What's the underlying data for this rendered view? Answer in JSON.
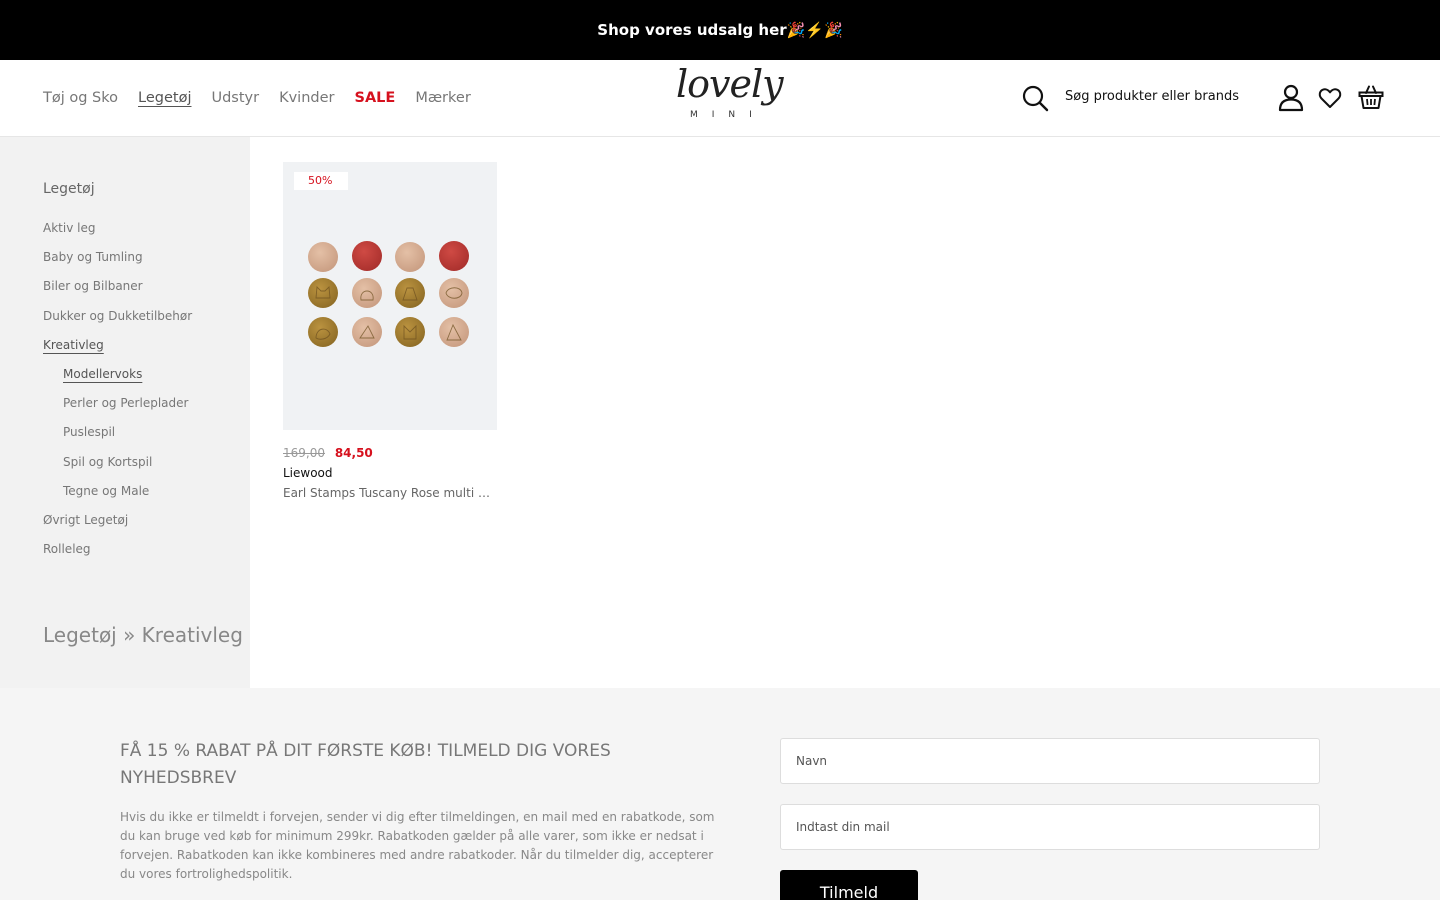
{
  "topbar": {
    "promo_text": "Shop vores udsalg her🎉⚡️🎉"
  },
  "nav": {
    "items": [
      {
        "label": "Tøj og Sko"
      },
      {
        "label": "Legetøj"
      },
      {
        "label": "Udstyr"
      },
      {
        "label": "Kvinder"
      },
      {
        "label": "SALE"
      },
      {
        "label": "Mærker"
      }
    ]
  },
  "logo": {
    "script": "lovely",
    "sub": "MINI"
  },
  "search": {
    "placeholder": "Søg produkter eller brands"
  },
  "icons": {
    "search": "search-icon",
    "account": "user-icon",
    "wishlist": "heart-icon",
    "cart": "basket-icon"
  },
  "sidebar": {
    "heading": "Legetøj",
    "categories": [
      {
        "label": "Aktiv leg"
      },
      {
        "label": "Baby og Tumling"
      },
      {
        "label": "Biler og Bilbaner"
      },
      {
        "label": "Dukker og Dukketilbehør"
      },
      {
        "label": "Kreativleg"
      },
      {
        "label": "Modellervoks"
      },
      {
        "label": "Perler og Perleplader"
      },
      {
        "label": "Puslespil"
      },
      {
        "label": "Spil og Kortspil"
      },
      {
        "label": "Tegne og Male"
      },
      {
        "label": "Øvrigt Legetøj"
      },
      {
        "label": "Rolleleg"
      }
    ],
    "breadcrumb": "Legetøj » Kreativleg"
  },
  "products": [
    {
      "badge": "50%",
      "old_price": "169,00",
      "new_price": "84,50",
      "brand": "Liewood",
      "name": "Earl Stamps Tuscany Rose multi mix"
    }
  ],
  "newsletter": {
    "title": "FÅ 15 % RABAT PÅ DIT FØRSTE KØB! TILMELD DIG VORES NYHEDSBREV",
    "text": "Hvis du ikke er tilmeldt i forvejen, sender vi dig efter tilmeldingen, en mail med en rabatkode, som du kan bruge ved køb for minimum 299kr. Rabatkoden gælder på alle varer, som ikke er nedsat i forvejen. Rabatkoden kan ikke kombineres med andre rabatkoder. Når du tilmelder dig, accepterer du vores fortrolighedspolitik.",
    "name_placeholder": "Navn",
    "mail_placeholder": "Indtast din mail",
    "button": "Tilmeld"
  },
  "colors": {
    "sale_red": "#d6111e",
    "topbar_bg": "#000000",
    "sidebar_bg": "#f2f2f2",
    "newsletter_bg": "#f5f5f5"
  }
}
